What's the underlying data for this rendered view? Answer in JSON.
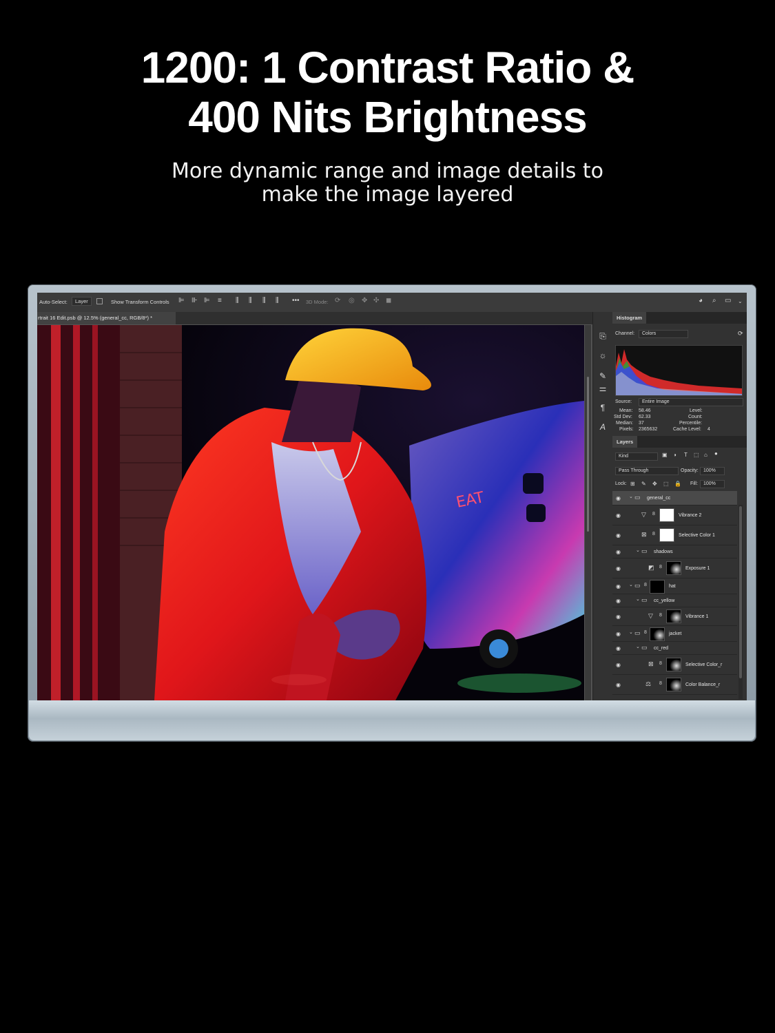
{
  "headline": {
    "line1": "1200: 1 Contrast Ratio &",
    "line2": "400 Nits Brightness"
  },
  "subheadline": {
    "line1": "More dynamic range and image details to",
    "line2": "make the image layered"
  },
  "options_bar": {
    "auto_select_label": "Auto-Select:",
    "auto_select_value": "Layer",
    "transform_label": "Show Transform Controls",
    "mode_3d_label": "3D Mode:"
  },
  "document": {
    "tab_title": "rtrait 16 Edit.psb @ 12.5% (general_cc, RGB/8*) *"
  },
  "histogram": {
    "tab": "Histogram",
    "channel_label": "Channel:",
    "channel_value": "Colors",
    "source_label": "Source:",
    "source_value": "Entire Image",
    "mean_label": "Mean:",
    "mean": "58.46",
    "stddev_label": "Std Dev:",
    "stddev": "62.33",
    "median_label": "Median:",
    "median": "37",
    "pixels_label": "Pixels:",
    "pixels": "2365632",
    "level_label": "Level:",
    "count_label": "Count:",
    "percentile_label": "Percentile:",
    "cache_label": "Cache Level:",
    "cache": "4"
  },
  "layers": {
    "tab": "Layers",
    "filter_value": "Kind",
    "blend_mode": "Pass Through",
    "opacity_label": "Opacity:",
    "opacity": "100%",
    "lock_label": "Lock:",
    "fill_label": "Fill:",
    "fill": "100%",
    "items": [
      {
        "name": "general_cc",
        "type": "group"
      },
      {
        "name": "Vibrance 2",
        "type": "adjustment"
      },
      {
        "name": "Selective Color 1",
        "type": "adjustment"
      },
      {
        "name": "shadows",
        "type": "group"
      },
      {
        "name": "Exposure 1",
        "type": "adjustment"
      },
      {
        "name": "hat",
        "type": "group-mask"
      },
      {
        "name": "cc_yellow",
        "type": "group"
      },
      {
        "name": "Vibrance 1",
        "type": "adjustment"
      },
      {
        "name": "jacket",
        "type": "group-mask"
      },
      {
        "name": "cc_red",
        "type": "group"
      },
      {
        "name": "Selective Color_r",
        "type": "adjustment"
      },
      {
        "name": "Color Balance_r",
        "type": "adjustment"
      }
    ]
  },
  "colors": {
    "accent_red": "#e0241c",
    "hat_yellow": "#f2b21a",
    "neon_blue": "#3a48e8",
    "panel_bg": "#323232"
  }
}
